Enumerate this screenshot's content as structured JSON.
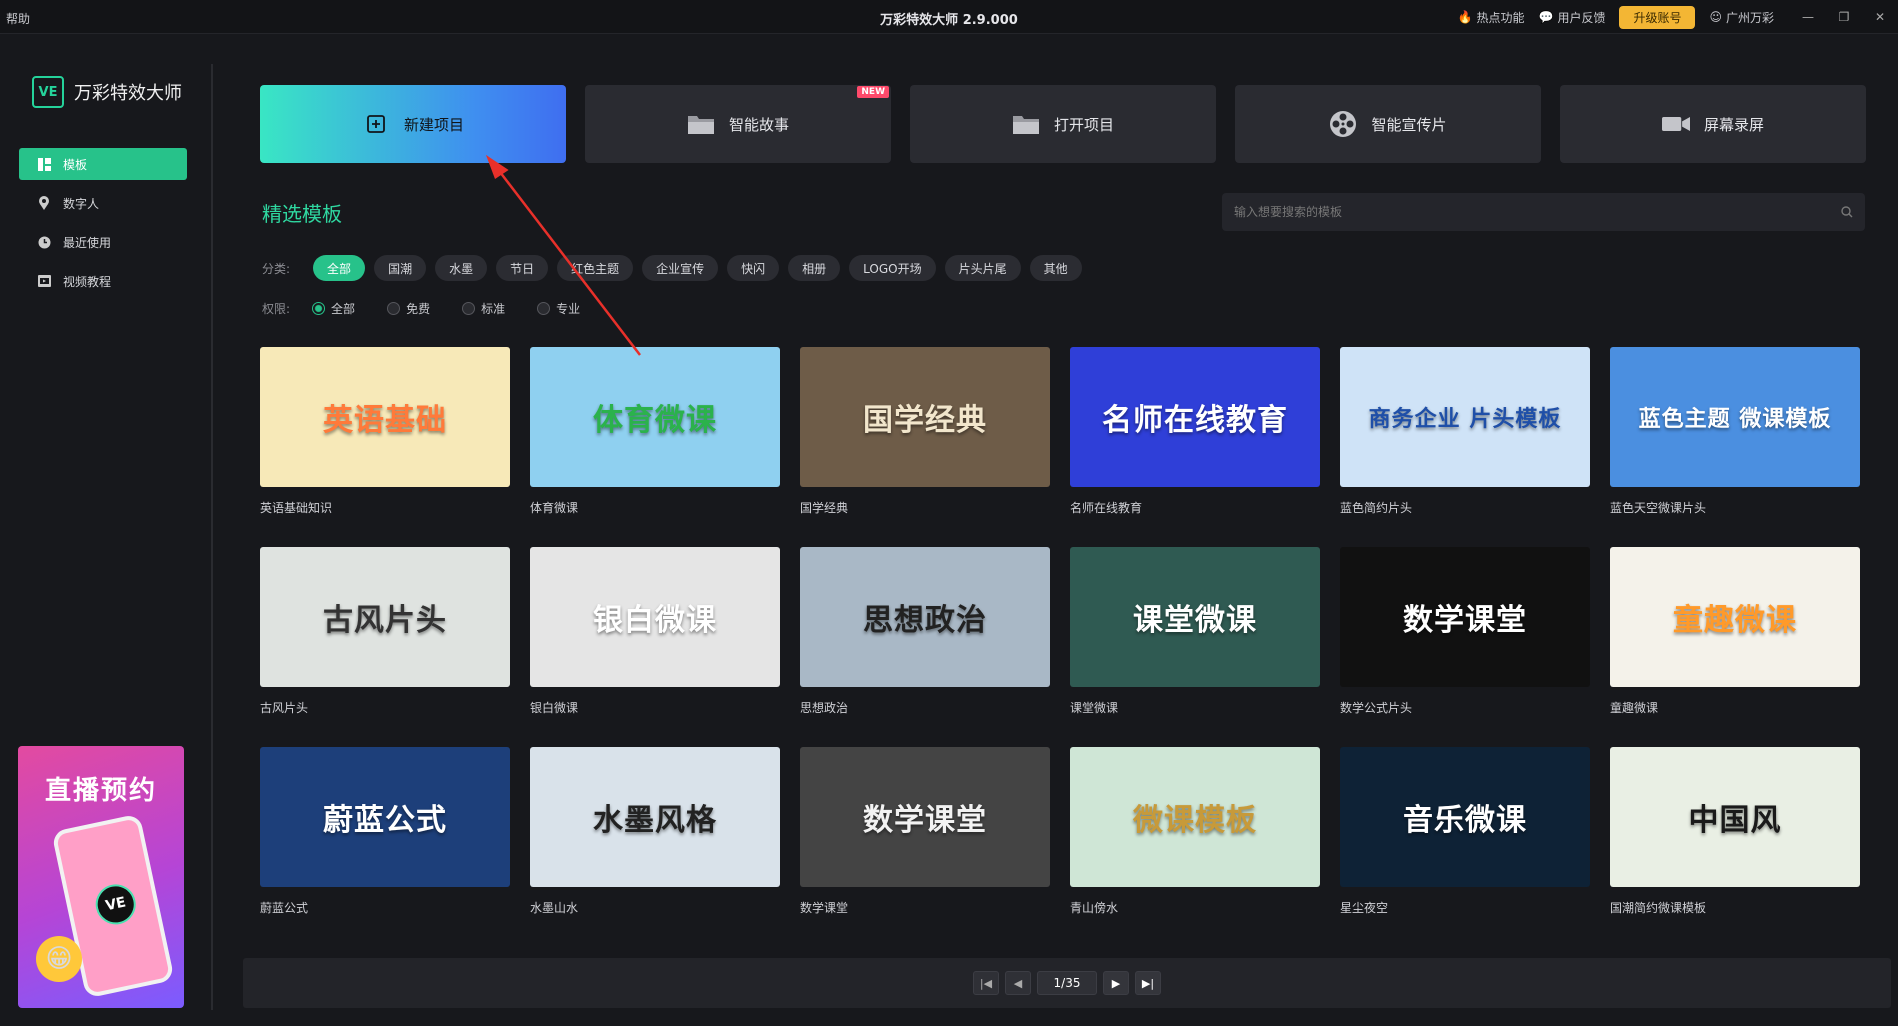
{
  "titlebar": {
    "help": "帮助",
    "title": "万彩特效大师 2.9.000",
    "hot": "热点功能",
    "feedback": "用户反馈",
    "upgrade": "升级账号",
    "user": "广州万彩"
  },
  "sidebar": {
    "logo_mark": "VE",
    "logo_text": "万彩特效大师",
    "items": [
      {
        "label": "模板",
        "icon": "template-icon",
        "active": true
      },
      {
        "label": "数字人",
        "icon": "digital-human-icon",
        "active": false
      },
      {
        "label": "最近使用",
        "icon": "clock-icon",
        "active": false
      },
      {
        "label": "视频教程",
        "icon": "video-icon",
        "active": false
      }
    ],
    "promo": {
      "title": "直播预约",
      "badge": "VE"
    }
  },
  "actions": [
    {
      "label": "新建项目",
      "icon": "plus-box-icon"
    },
    {
      "label": "智能故事",
      "icon": "folder-icon",
      "badge": "NEW"
    },
    {
      "label": "打开项目",
      "icon": "folder-icon"
    },
    {
      "label": "智能宣传片",
      "icon": "film-reel-icon"
    },
    {
      "label": "屏幕录屏",
      "icon": "camera-icon"
    }
  ],
  "section_title": "精选模板",
  "search": {
    "placeholder": "输入想要搜索的模板"
  },
  "filters": {
    "category_label": "分类:",
    "categories": [
      "全部",
      "国潮",
      "水墨",
      "节日",
      "红色主题",
      "企业宣传",
      "快闪",
      "相册",
      "LOGO开场",
      "片头片尾",
      "其他"
    ],
    "active_category": "全部",
    "permission_label": "权限:",
    "permissions": [
      "全部",
      "免费",
      "标准",
      "专业"
    ],
    "active_permission": "全部"
  },
  "templates": [
    {
      "caption": "英语基础知识",
      "thumb_text": "英语基础",
      "bg": "#f7e9b8",
      "fg": "#ff7a3a"
    },
    {
      "caption": "体育微课",
      "thumb_text": "体育微课",
      "bg": "#8fd0f0",
      "fg": "#2bb24c"
    },
    {
      "caption": "国学经典",
      "thumb_text": "国学经典",
      "bg": "#6e5c48",
      "fg": "#f2e6cc"
    },
    {
      "caption": "名师在线教育",
      "thumb_text": "名师在线教育",
      "bg": "#2f3fd8",
      "fg": "#ffffff"
    },
    {
      "caption": "蓝色简约片头",
      "thumb_text": "商务企业 片头模板",
      "bg": "#cfe3f7",
      "fg": "#1f4fa8"
    },
    {
      "caption": "蓝色天空微课片头",
      "thumb_text": "蓝色主题 微课模板",
      "bg": "#4b8fe0",
      "fg": "#ffffff"
    },
    {
      "caption": "古风片头",
      "thumb_text": "古风片头",
      "bg": "#dfe3e0",
      "fg": "#333333"
    },
    {
      "caption": "银白微课",
      "thumb_text": "银白微课",
      "bg": "#e5e5e5",
      "fg": "#ffffff"
    },
    {
      "caption": "思想政治",
      "thumb_text": "思想政治",
      "bg": "#a9b8c6",
      "fg": "#222222"
    },
    {
      "caption": "课堂微课",
      "thumb_text": "课堂微课",
      "bg": "#2f5a52",
      "fg": "#ffffff"
    },
    {
      "caption": "数学公式片头",
      "thumb_text": "数学课堂",
      "bg": "#111111",
      "fg": "#ffffff"
    },
    {
      "caption": "童趣微课",
      "thumb_text": "童趣微课",
      "bg": "#f4f2ea",
      "fg": "#ff9a2a"
    },
    {
      "caption": "蔚蓝公式",
      "thumb_text": "蔚蓝公式",
      "bg": "#1d3f7a",
      "fg": "#ffffff"
    },
    {
      "caption": "水墨山水",
      "thumb_text": "水墨风格",
      "bg": "#d9e2ea",
      "fg": "#222222"
    },
    {
      "caption": "数学课堂",
      "thumb_text": "数学课堂",
      "bg": "#444444",
      "fg": "#f2f2f2"
    },
    {
      "caption": "青山傍水",
      "thumb_text": "微课模板",
      "bg": "#cfe6d6",
      "fg": "#c79a3a"
    },
    {
      "caption": "星尘夜空",
      "thumb_text": "音乐微课",
      "bg": "#0e2236",
      "fg": "#ffffff"
    },
    {
      "caption": "国潮简约微课模板",
      "thumb_text": "中国风",
      "bg": "#e9efe4",
      "fg": "#1a1a1a"
    }
  ],
  "pagination": {
    "current": "1/35"
  }
}
